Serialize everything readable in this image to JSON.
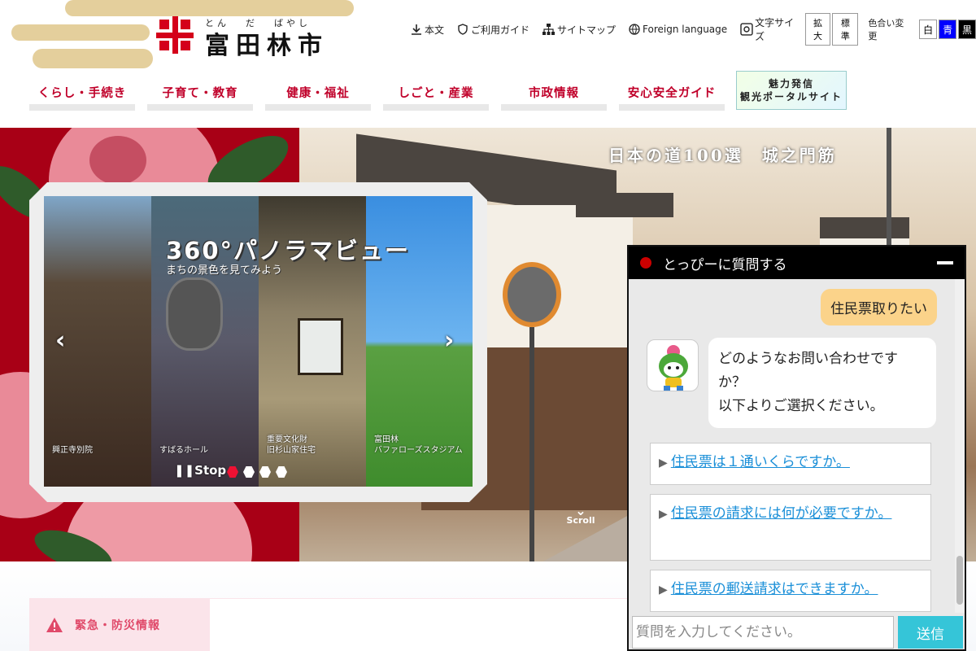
{
  "header": {
    "logo_ruby": [
      "とん",
      "だ",
      "ばやし"
    ],
    "logo_name": "富田林市",
    "util_links": [
      {
        "icon": "download-icon",
        "label": "本文"
      },
      {
        "icon": "shield-icon",
        "label": "ご利用ガイド"
      },
      {
        "icon": "sitemap-icon",
        "label": "サイトマップ"
      },
      {
        "icon": "globe-icon",
        "label": "Foreign language"
      }
    ],
    "font_size_label": "文字サイズ",
    "font_size_buttons": [
      "拡大",
      "標準"
    ],
    "color_label": "色合い変更",
    "color_buttons": [
      {
        "label": "白",
        "bg": "#ffffff",
        "fg": "#000000"
      },
      {
        "label": "青",
        "bg": "#0000ff",
        "fg": "#ffffff"
      },
      {
        "label": "黒",
        "bg": "#000000",
        "fg": "#ffffff"
      }
    ]
  },
  "gnav": {
    "items": [
      "くらし・手続き",
      "子育て・教育",
      "健康・福祉",
      "しごと・産業",
      "市政情報",
      "安心安全ガイド"
    ],
    "portal_line1": "魅力発信",
    "portal_line2": "観光ポータルサイト"
  },
  "hero": {
    "road_title": "日本の道100選　城之門筋",
    "scroll_label": "Scroll",
    "panorama_title": "360°パノラマビュー",
    "panorama_sub": "まちの景色を見てみよう",
    "panels": [
      {
        "caption1": "興正寺別院",
        "caption2": ""
      },
      {
        "caption1": "すばるホール",
        "caption2": ""
      },
      {
        "caption1": "重要文化財",
        "caption2": "旧杉山家住宅"
      },
      {
        "caption1": "富田林",
        "caption2": "バファローズスタジアム"
      }
    ],
    "stop_label": "Stop",
    "active_dot_color": "#ee1133"
  },
  "emergency": {
    "label": "緊急・防災情報"
  },
  "chat": {
    "title": "とっぴーに質問する",
    "user_message": "住民票取りたい",
    "bot_message": [
      "どのようなお問い合わせです",
      "か？",
      "以下よりご選択ください。"
    ],
    "options": [
      "住民票は１通いくらですか。",
      "住民票の請求には何が必要ですか。",
      "住民票の郵送請求はできますか。"
    ],
    "input_placeholder": "質問を入力してください。",
    "send_label": "送信"
  }
}
